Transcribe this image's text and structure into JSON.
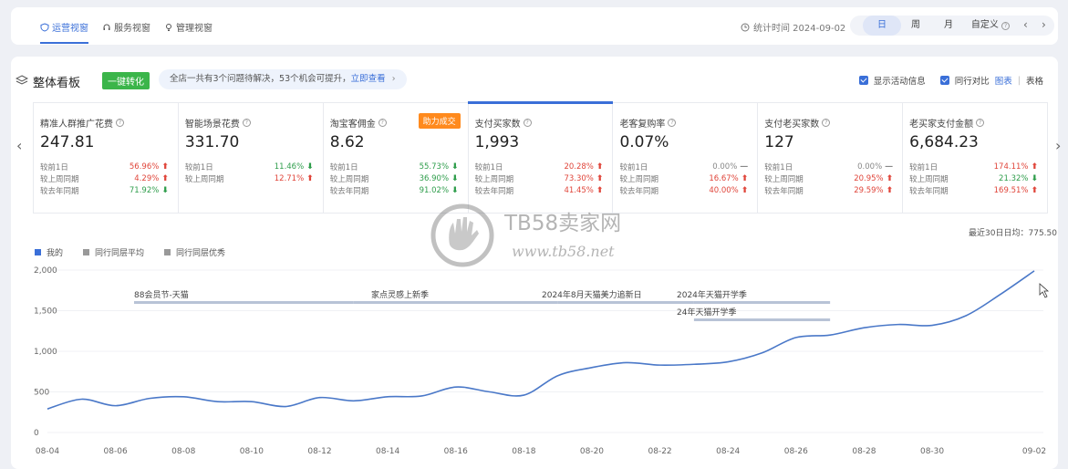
{
  "topbar": {
    "tabs": [
      {
        "label": "运营视窗",
        "icon": "shield-icon",
        "active": true
      },
      {
        "label": "服务视窗",
        "icon": "headset-icon",
        "active": false
      },
      {
        "label": "管理视窗",
        "icon": "bulb-icon",
        "active": false
      }
    ],
    "stat_time": "统计时间 2024-09-02",
    "periods": [
      "日",
      "周",
      "月",
      "自定义"
    ],
    "active_period": "日",
    "prev_label": "‹",
    "next_label": "›"
  },
  "panel": {
    "title": "整体看板",
    "one_click": "一键转化",
    "notice_text": "全店一共有3个问题待解决，53个机会可提升，",
    "notice_link": "立即查看",
    "notice_arrow": "›",
    "opt_activity": "显示活动信息",
    "opt_peer": "同行对比",
    "view_chart": "图表",
    "view_sep": "|",
    "view_table": "表格",
    "prev_arrow": "‹",
    "next_arrow": "›"
  },
  "metrics": [
    {
      "label": "精准人群推广花费",
      "value": "247.81",
      "badge": "",
      "rows": [
        {
          "name": "较前1日",
          "val": "56.96%",
          "dir": "up"
        },
        {
          "name": "较上周同期",
          "val": "4.29%",
          "dir": "up"
        },
        {
          "name": "较去年同期",
          "val": "71.92%",
          "dir": "down"
        }
      ]
    },
    {
      "label": "智能场景花费",
      "value": "331.70",
      "badge": "",
      "rows": [
        {
          "name": "较前1日",
          "val": "11.46%",
          "dir": "down"
        },
        {
          "name": "较上周同期",
          "val": "12.71%",
          "dir": "up"
        }
      ]
    },
    {
      "label": "淘宝客佣金",
      "value": "8.62",
      "badge": "助力成交",
      "rows": [
        {
          "name": "较前1日",
          "val": "55.73%",
          "dir": "down"
        },
        {
          "name": "较上周同期",
          "val": "36.90%",
          "dir": "down"
        },
        {
          "name": "较去年同期",
          "val": "91.02%",
          "dir": "down"
        }
      ]
    },
    {
      "label": "支付买家数",
      "value": "1,993",
      "badge": "",
      "selected": true,
      "rows": [
        {
          "name": "较前1日",
          "val": "20.28%",
          "dir": "up"
        },
        {
          "name": "较上周同期",
          "val": "73.30%",
          "dir": "up"
        },
        {
          "name": "较去年同期",
          "val": "41.45%",
          "dir": "up"
        }
      ]
    },
    {
      "label": "老客复购率",
      "value": "0.07%",
      "badge": "",
      "rows": [
        {
          "name": "较前1日",
          "val": "0.00%",
          "dir": "flat"
        },
        {
          "name": "较上周同期",
          "val": "16.67%",
          "dir": "up"
        },
        {
          "name": "较去年同期",
          "val": "40.00%",
          "dir": "up"
        }
      ]
    },
    {
      "label": "支付老买家数",
      "value": "127",
      "badge": "",
      "rows": [
        {
          "name": "较前1日",
          "val": "0.00%",
          "dir": "flat"
        },
        {
          "name": "较上周同期",
          "val": "20.95%",
          "dir": "up"
        },
        {
          "name": "较去年同期",
          "val": "29.59%",
          "dir": "up"
        }
      ]
    },
    {
      "label": "老买家支付金额",
      "value": "6,684.23",
      "badge": "",
      "rows": [
        {
          "name": "较前1日",
          "val": "174.11%",
          "dir": "up"
        },
        {
          "name": "较上周同期",
          "val": "21.32%",
          "dir": "down"
        },
        {
          "name": "较去年同期",
          "val": "169.51%",
          "dir": "up"
        }
      ]
    }
  ],
  "arrows": {
    "up": "⬆",
    "down": "⬇",
    "flat": "—"
  },
  "chart_data": {
    "type": "line",
    "recent_avg": "最近30日日均：775.50",
    "legend": [
      {
        "name": "我的",
        "color": "#3a6fd8"
      },
      {
        "name": "同行同层平均",
        "color": "#999999"
      },
      {
        "name": "同行同层优秀",
        "color": "#999999"
      }
    ],
    "x": [
      "08-04",
      "08-05",
      "08-06",
      "08-07",
      "08-08",
      "08-09",
      "08-10",
      "08-11",
      "08-12",
      "08-13",
      "08-14",
      "08-15",
      "08-16",
      "08-17",
      "08-18",
      "08-19",
      "08-20",
      "08-21",
      "08-22",
      "08-23",
      "08-24",
      "08-25",
      "08-26",
      "08-27",
      "08-28",
      "08-29",
      "08-30",
      "08-31",
      "09-01",
      "09-02"
    ],
    "x_ticks": [
      "08-04",
      "08-06",
      "08-08",
      "08-10",
      "08-12",
      "08-14",
      "08-16",
      "08-18",
      "08-20",
      "08-22",
      "08-24",
      "08-26",
      "08-28",
      "08-30",
      "09-02"
    ],
    "series": [
      {
        "name": "我的",
        "values": [
          290,
          410,
          330,
          420,
          440,
          380,
          380,
          320,
          430,
          390,
          440,
          450,
          560,
          500,
          460,
          700,
          800,
          860,
          830,
          840,
          870,
          980,
          1170,
          1200,
          1290,
          1330,
          1320,
          1440,
          1700,
          1990
        ]
      }
    ],
    "ylim": [
      0,
      2000
    ],
    "y_ticks": [
      "0",
      "500",
      "1,000",
      "1,500",
      "2,000"
    ],
    "y_tick_values": [
      0,
      500,
      1000,
      1500,
      2000
    ],
    "activities": [
      {
        "label": "88会员节-天猫",
        "start": "08-04",
        "end": "08-13",
        "row": 0
      },
      {
        "label": "家点灵感上新季",
        "start": "08-13",
        "end": "08-19",
        "row": 0
      },
      {
        "label": "2024年8月天猫美力追新日",
        "start": "08-19",
        "end": "08-23",
        "row": 0
      },
      {
        "label": "2024年天猫开学季",
        "start": "08-23",
        "end": "08-27",
        "row": 0
      },
      {
        "label": "24年天猫开学季",
        "start": "08-23",
        "end": "08-27",
        "row": 1
      }
    ],
    "grid": true,
    "legend_position": "top-left"
  },
  "watermark": {
    "title": "TB58卖家网",
    "url": "www.tb58.net"
  }
}
